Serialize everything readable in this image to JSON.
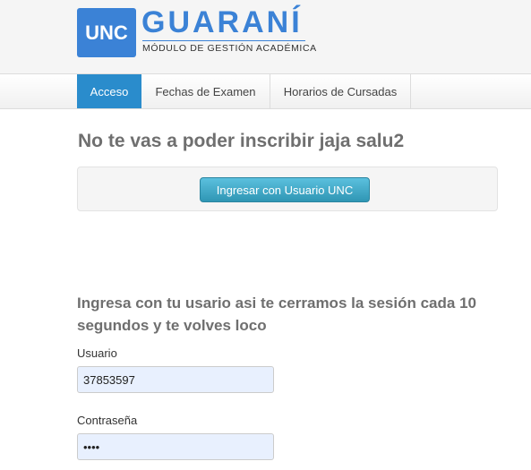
{
  "header": {
    "logo_text": "UNC",
    "brand": "GUARANÍ",
    "subtitle": "MÓDULO DE GESTIÓN ACADÉMICA",
    "brand_color": "#3b82d6"
  },
  "nav": {
    "items": [
      {
        "label": "Acceso",
        "active": true
      },
      {
        "label": "Fechas de Examen",
        "active": false
      },
      {
        "label": "Horarios de Cursadas",
        "active": false
      }
    ],
    "active_color": "#2a8ccc"
  },
  "main": {
    "title": "No te vas a poder inscribir jaja salu2",
    "unc_button_label": "Ingresar con Usuario UNC",
    "login_heading": "Ingresa con tu usario asi te cerramos la sesión cada 10 segundos y te volves loco",
    "usuario_label": "Usuario",
    "usuario_value": "37853597",
    "password_label": "Contraseña",
    "password_value": "1234"
  }
}
